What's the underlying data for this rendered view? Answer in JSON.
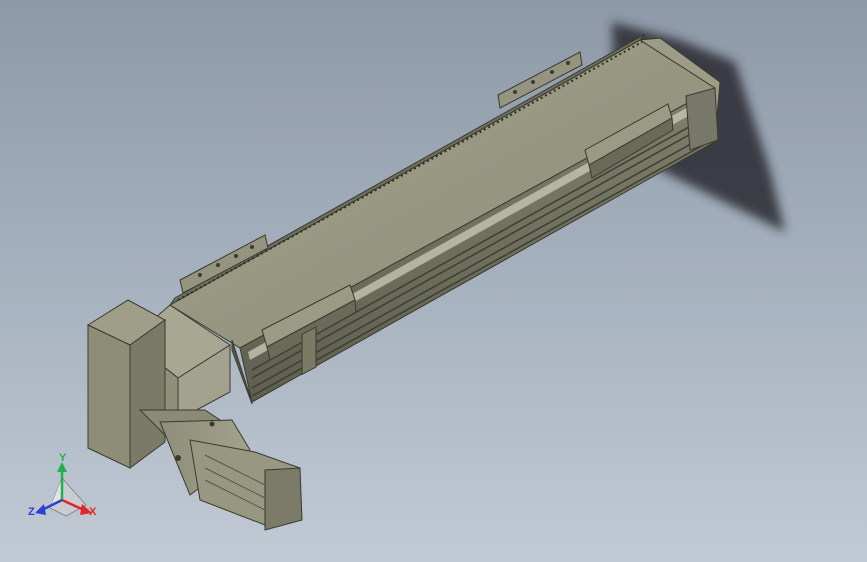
{
  "viewport": {
    "background_top": "#8e99a8",
    "background_bottom": "#c1cad4"
  },
  "model": {
    "body_color": "#8f8f7a",
    "shadow_color": "#2a2c30"
  },
  "triad": {
    "y_label": "Y",
    "x_label": "X",
    "z_label": "Z",
    "y_color": "#22b04a",
    "x_color": "#e0252b",
    "z_color": "#2b3fd6"
  }
}
